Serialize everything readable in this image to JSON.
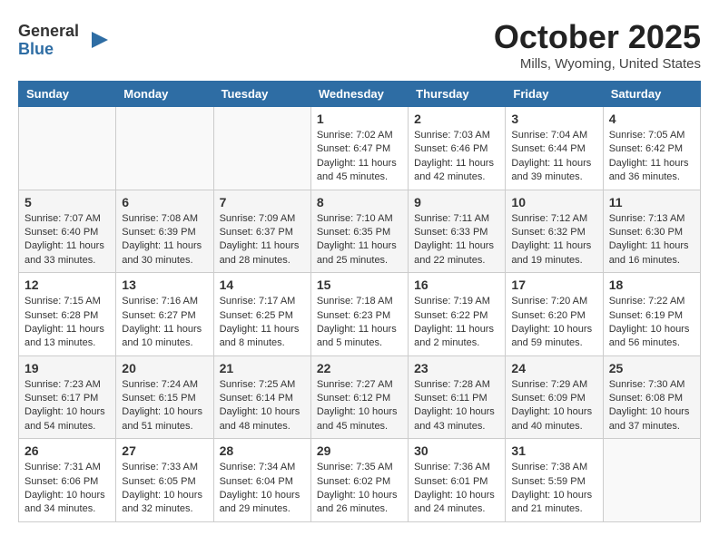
{
  "logo": {
    "general": "General",
    "blue": "Blue"
  },
  "title": "October 2025",
  "subtitle": "Mills, Wyoming, United States",
  "headers": [
    "Sunday",
    "Monday",
    "Tuesday",
    "Wednesday",
    "Thursday",
    "Friday",
    "Saturday"
  ],
  "weeks": [
    [
      {
        "day": "",
        "info": ""
      },
      {
        "day": "",
        "info": ""
      },
      {
        "day": "",
        "info": ""
      },
      {
        "day": "1",
        "info": "Sunrise: 7:02 AM\nSunset: 6:47 PM\nDaylight: 11 hours and 45 minutes."
      },
      {
        "day": "2",
        "info": "Sunrise: 7:03 AM\nSunset: 6:46 PM\nDaylight: 11 hours and 42 minutes."
      },
      {
        "day": "3",
        "info": "Sunrise: 7:04 AM\nSunset: 6:44 PM\nDaylight: 11 hours and 39 minutes."
      },
      {
        "day": "4",
        "info": "Sunrise: 7:05 AM\nSunset: 6:42 PM\nDaylight: 11 hours and 36 minutes."
      }
    ],
    [
      {
        "day": "5",
        "info": "Sunrise: 7:07 AM\nSunset: 6:40 PM\nDaylight: 11 hours and 33 minutes."
      },
      {
        "day": "6",
        "info": "Sunrise: 7:08 AM\nSunset: 6:39 PM\nDaylight: 11 hours and 30 minutes."
      },
      {
        "day": "7",
        "info": "Sunrise: 7:09 AM\nSunset: 6:37 PM\nDaylight: 11 hours and 28 minutes."
      },
      {
        "day": "8",
        "info": "Sunrise: 7:10 AM\nSunset: 6:35 PM\nDaylight: 11 hours and 25 minutes."
      },
      {
        "day": "9",
        "info": "Sunrise: 7:11 AM\nSunset: 6:33 PM\nDaylight: 11 hours and 22 minutes."
      },
      {
        "day": "10",
        "info": "Sunrise: 7:12 AM\nSunset: 6:32 PM\nDaylight: 11 hours and 19 minutes."
      },
      {
        "day": "11",
        "info": "Sunrise: 7:13 AM\nSunset: 6:30 PM\nDaylight: 11 hours and 16 minutes."
      }
    ],
    [
      {
        "day": "12",
        "info": "Sunrise: 7:15 AM\nSunset: 6:28 PM\nDaylight: 11 hours and 13 minutes."
      },
      {
        "day": "13",
        "info": "Sunrise: 7:16 AM\nSunset: 6:27 PM\nDaylight: 11 hours and 10 minutes."
      },
      {
        "day": "14",
        "info": "Sunrise: 7:17 AM\nSunset: 6:25 PM\nDaylight: 11 hours and 8 minutes."
      },
      {
        "day": "15",
        "info": "Sunrise: 7:18 AM\nSunset: 6:23 PM\nDaylight: 11 hours and 5 minutes."
      },
      {
        "day": "16",
        "info": "Sunrise: 7:19 AM\nSunset: 6:22 PM\nDaylight: 11 hours and 2 minutes."
      },
      {
        "day": "17",
        "info": "Sunrise: 7:20 AM\nSunset: 6:20 PM\nDaylight: 10 hours and 59 minutes."
      },
      {
        "day": "18",
        "info": "Sunrise: 7:22 AM\nSunset: 6:19 PM\nDaylight: 10 hours and 56 minutes."
      }
    ],
    [
      {
        "day": "19",
        "info": "Sunrise: 7:23 AM\nSunset: 6:17 PM\nDaylight: 10 hours and 54 minutes."
      },
      {
        "day": "20",
        "info": "Sunrise: 7:24 AM\nSunset: 6:15 PM\nDaylight: 10 hours and 51 minutes."
      },
      {
        "day": "21",
        "info": "Sunrise: 7:25 AM\nSunset: 6:14 PM\nDaylight: 10 hours and 48 minutes."
      },
      {
        "day": "22",
        "info": "Sunrise: 7:27 AM\nSunset: 6:12 PM\nDaylight: 10 hours and 45 minutes."
      },
      {
        "day": "23",
        "info": "Sunrise: 7:28 AM\nSunset: 6:11 PM\nDaylight: 10 hours and 43 minutes."
      },
      {
        "day": "24",
        "info": "Sunrise: 7:29 AM\nSunset: 6:09 PM\nDaylight: 10 hours and 40 minutes."
      },
      {
        "day": "25",
        "info": "Sunrise: 7:30 AM\nSunset: 6:08 PM\nDaylight: 10 hours and 37 minutes."
      }
    ],
    [
      {
        "day": "26",
        "info": "Sunrise: 7:31 AM\nSunset: 6:06 PM\nDaylight: 10 hours and 34 minutes."
      },
      {
        "day": "27",
        "info": "Sunrise: 7:33 AM\nSunset: 6:05 PM\nDaylight: 10 hours and 32 minutes."
      },
      {
        "day": "28",
        "info": "Sunrise: 7:34 AM\nSunset: 6:04 PM\nDaylight: 10 hours and 29 minutes."
      },
      {
        "day": "29",
        "info": "Sunrise: 7:35 AM\nSunset: 6:02 PM\nDaylight: 10 hours and 26 minutes."
      },
      {
        "day": "30",
        "info": "Sunrise: 7:36 AM\nSunset: 6:01 PM\nDaylight: 10 hours and 24 minutes."
      },
      {
        "day": "31",
        "info": "Sunrise: 7:38 AM\nSunset: 5:59 PM\nDaylight: 10 hours and 21 minutes."
      },
      {
        "day": "",
        "info": ""
      }
    ]
  ]
}
